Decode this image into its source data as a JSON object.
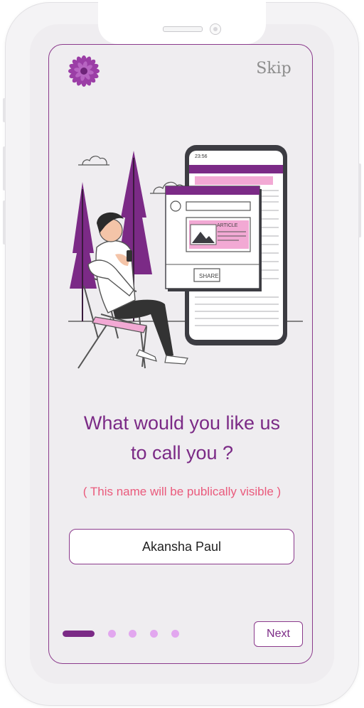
{
  "header": {
    "skip_label": "Skip",
    "logo_icon": "purple-flower-icon"
  },
  "illustration": {
    "phone_time": "23:56",
    "article_label": "ARTICLE",
    "share_label": "SHARE"
  },
  "prompt": {
    "title_line1": "What would you like us",
    "title_line2": "to call you ?",
    "subtitle": "( This name will be publically visible )"
  },
  "name_field": {
    "value": "Akansha Paul"
  },
  "pagination": {
    "total": 5,
    "current": 1
  },
  "footer": {
    "next_label": "Next"
  },
  "colors": {
    "brand": "#7b2a86",
    "accent_pink": "#ea5a7c",
    "dot_inactive": "#e2a7ef",
    "background": "#efedf0"
  }
}
